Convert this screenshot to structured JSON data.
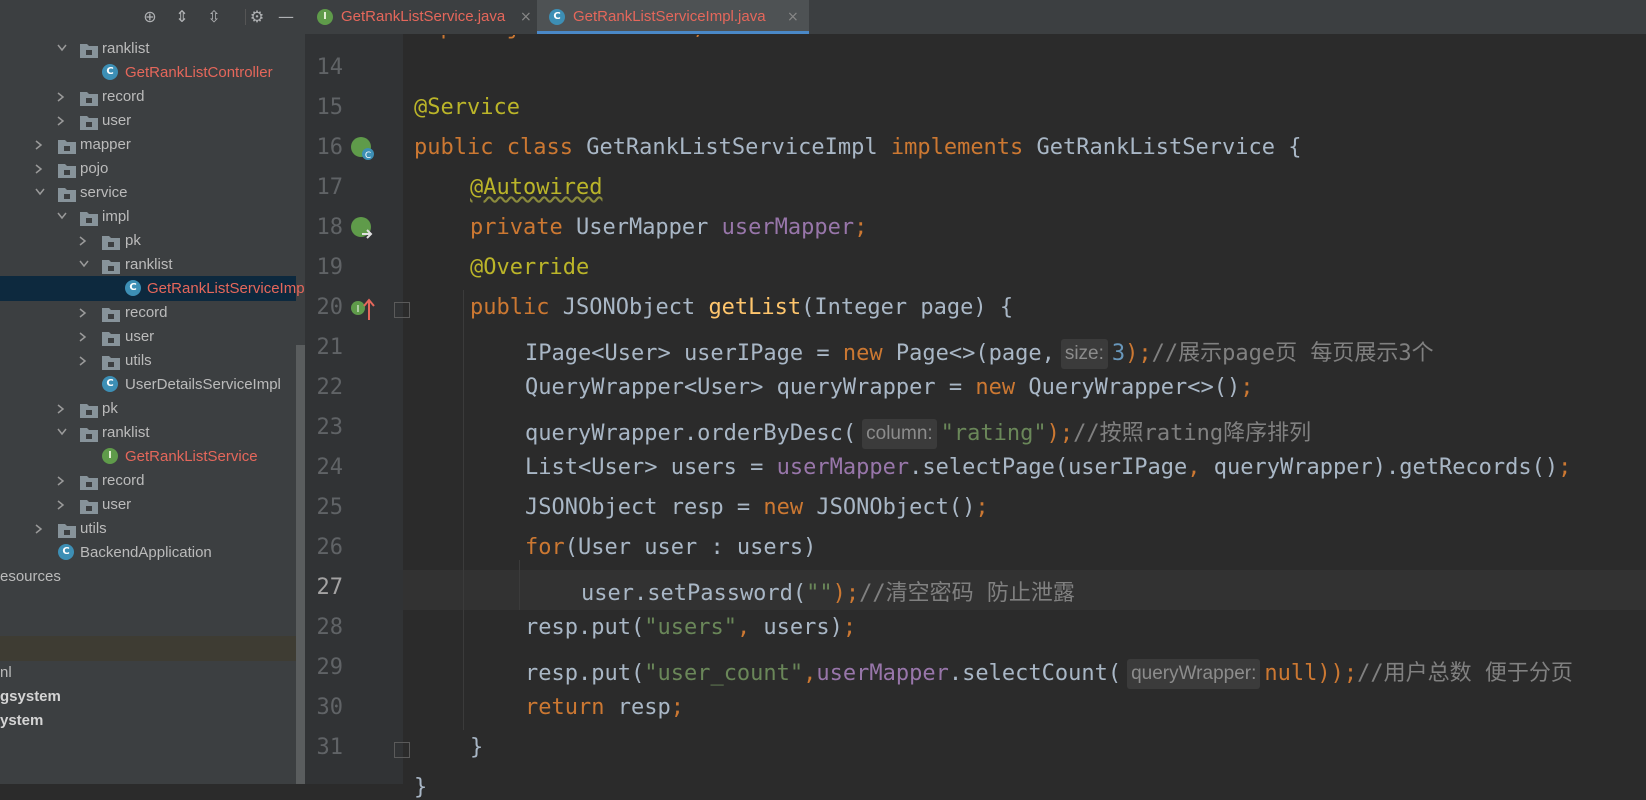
{
  "tabs": [
    {
      "label": "GetRankListService.java",
      "icon": "I",
      "close": "×"
    },
    {
      "label": "GetRankListServiceImpl.java",
      "icon": "C",
      "close": "×"
    }
  ],
  "toolbar": {
    "icons": [
      "crosshair-icon",
      "expand-all-icon",
      "collapse-all-icon",
      "gear-icon",
      "minimize-icon"
    ],
    "glyphs": [
      "⊕",
      "⇕",
      "⇳",
      "⚙",
      "—"
    ]
  },
  "tree": [
    {
      "label": "ranklist"
    },
    {
      "label": "GetRankListController"
    },
    {
      "label": "record"
    },
    {
      "label": "user"
    },
    {
      "label": "mapper"
    },
    {
      "label": "pojo"
    },
    {
      "label": "service"
    },
    {
      "label": "impl"
    },
    {
      "label": "pk"
    },
    {
      "label": "ranklist"
    },
    {
      "label": "GetRankListServiceImpl"
    },
    {
      "label": "record"
    },
    {
      "label": "user"
    },
    {
      "label": "utils"
    },
    {
      "label": "UserDetailsServiceImpl"
    },
    {
      "label": "pk"
    },
    {
      "label": "ranklist"
    },
    {
      "label": "GetRankListService"
    },
    {
      "label": "record"
    },
    {
      "label": "user"
    },
    {
      "label": "utils"
    },
    {
      "label": "BackendApplication"
    },
    {
      "label": "esources"
    },
    {
      "label": ""
    },
    {
      "label": "nl"
    },
    {
      "label": "gsystem"
    },
    {
      "label": "ystem"
    }
  ],
  "editor": {
    "line_numbers": [
      "14",
      "15",
      "16",
      "17",
      "18",
      "19",
      "20",
      "21",
      "22",
      "23",
      "24",
      "25",
      "26",
      "27",
      "28",
      "29",
      "30",
      "31"
    ],
    "current_line": "27",
    "code": {
      "l13": "import java.util.List;",
      "l15a": "@Service",
      "l16a": "public class",
      "l16b": " GetRankListServiceImpl ",
      "l16c": "implements",
      "l16d": " GetRankListService {",
      "l17a": "@Autowired",
      "l18a": "private",
      "l18b": " UserMapper ",
      "l18c": "userMapper",
      "l18d": ";",
      "l19a": "@Override",
      "l20a": "public",
      "l20b": " JSONObject ",
      "l20c": "getList",
      "l20d": "(Integer page) {",
      "l21a": "IPage<User> userIPage = ",
      "l21b": "new",
      "l21c": " Page<>(page,",
      "l21h": "size:",
      "l21d": "3",
      "l21e": ");",
      "l21f": "//展示page页 每页展示3个",
      "l22a": "QueryWrapper<User> queryWrapper = ",
      "l22b": "new",
      "l22c": " QueryWrapper<>()",
      "l22d": ";",
      "l23a": "queryWrapper.orderByDesc(",
      "l23h": "column:",
      "l23b": "\"rating\"",
      "l23c": ");",
      "l23d": "//按照rating降序排列",
      "l24a": "List<User> users = ",
      "l24b": "userMapper",
      "l24c": ".selectPage(userIPage",
      "l24d": ",",
      "l24e": " queryWrapper).getRecords()",
      "l24f": ";",
      "l25a": "JSONObject resp = ",
      "l25b": "new",
      "l25c": " JSONObject()",
      "l25d": ";",
      "l26a": "for",
      "l26b": "(User user : users)",
      "l27a": "user.setPassword(",
      "l27b": "\"\"",
      "l27c": ");",
      "l27d": "//清空密码 防止泄露",
      "l28a": "resp.put(",
      "l28b": "\"users\"",
      "l28c": ",",
      "l28d": " users)",
      "l28e": ";",
      "l29a": "resp.put(",
      "l29b": "\"user_count\"",
      "l29c": ",",
      "l29d": "userMapper",
      "l29e": ".selectCount(",
      "l29h": "queryWrapper:",
      "l29f": "null",
      "l29g": "));",
      "l29i": "//用户总数 便于分页",
      "l30a": "return",
      "l30b": " resp",
      "l30c": ";",
      "l31a": "}",
      "l32a": "}"
    }
  }
}
